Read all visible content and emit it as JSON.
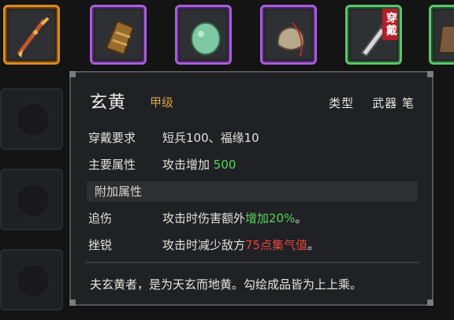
{
  "item": {
    "name": "玄黄",
    "grade": "甲级",
    "type_label": "类型",
    "type_value": "武器 笔"
  },
  "equip_tag": "穿戴",
  "requirements": {
    "label": "穿戴要求",
    "value": "短兵100、福缘10"
  },
  "main_attr": {
    "label": "主要属性",
    "prefix": "攻击增加",
    "amount": "500"
  },
  "extra_section": "附加属性",
  "extras": [
    {
      "label": "追伤",
      "prefix": "攻击时伤害额外",
      "highlight": "增加20%",
      "suffix": "。"
    },
    {
      "label": "挫锐",
      "prefix": "攻击时减少敌方",
      "highlight": "75点集气值",
      "suffix": "。"
    }
  ],
  "flavor": "夫玄黄者，是为天玄而地黄。勾绘成品皆为上上乘。",
  "colors": {
    "grade": "#d4a13a",
    "positive": "#57d35a",
    "negative": "#e0453e"
  },
  "slot_icons": [
    "brush-icon",
    "tome-icon",
    "jade-icon",
    "pouch-icon",
    "blade-icon",
    "armor-icon"
  ]
}
